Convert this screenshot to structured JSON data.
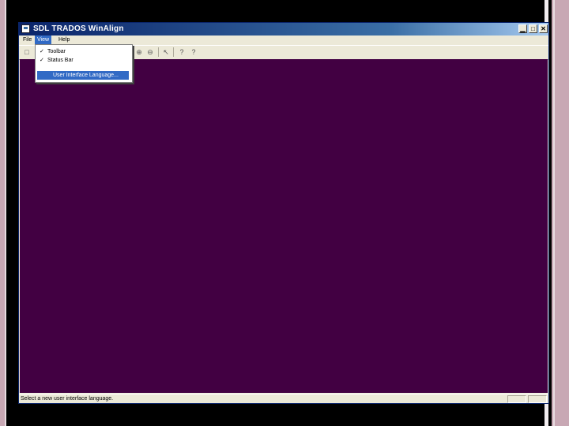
{
  "window": {
    "title": "SDL TRADOS WinAlign",
    "controls": {
      "minimize": "▁",
      "maximize": "□",
      "close": "✕"
    }
  },
  "menubar": {
    "items": [
      "File",
      "View",
      "Help"
    ],
    "active": "View"
  },
  "view_menu": {
    "items": [
      {
        "label": "Toolbar",
        "checked": true,
        "check": "✓"
      },
      {
        "label": "Status Bar",
        "checked": true,
        "check": "✓"
      },
      {
        "label": "User Interface Language...",
        "checked": false,
        "selected": true
      }
    ]
  },
  "toolbar": {
    "icons": [
      "new-icon",
      "zoom-in-icon",
      "zoom-out-icon",
      "pointer-icon",
      "help-pointer-icon",
      "context-help-icon"
    ],
    "glyphs": {
      "new": "□",
      "zoom_in": "⊕",
      "zoom_out": "⊖",
      "pointer": "↖",
      "help1": "?",
      "help2": "?"
    }
  },
  "statusbar": {
    "text": "Select a new user interface language."
  },
  "colors": {
    "client_bg": "#420042",
    "titlebar": "#0a246a",
    "highlight": "#316ac5"
  }
}
